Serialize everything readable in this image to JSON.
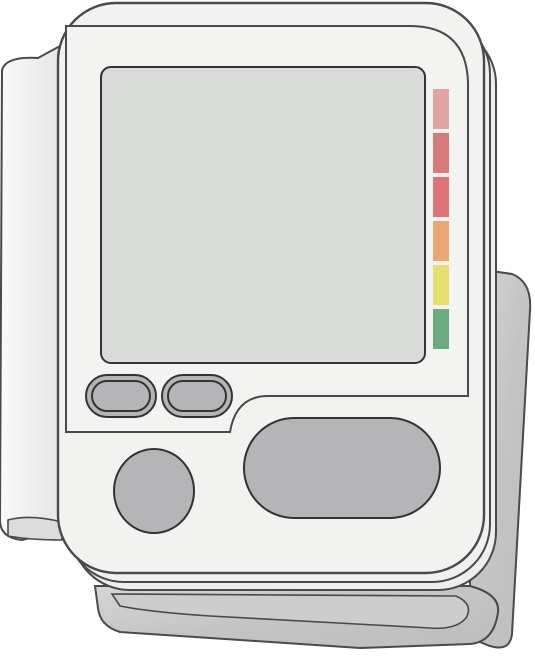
{
  "device": {
    "type": "wrist blood pressure monitor",
    "colors": {
      "body": "#f2f2f0",
      "outline": "#4a4a4a",
      "screen": "#d9dbd9",
      "buttons": "#b5b5b7",
      "cuff": "#c8c8c8",
      "strap": "#eeeeee"
    },
    "indicator_levels": [
      {
        "level": "level-1",
        "color": "#e2a3a3"
      },
      {
        "level": "level-2",
        "color": "#d97a7a"
      },
      {
        "level": "level-3",
        "color": "#de7478"
      },
      {
        "level": "level-4",
        "color": "#eba676"
      },
      {
        "level": "level-5",
        "color": "#e5df6f"
      },
      {
        "level": "level-6",
        "color": "#6aab80"
      }
    ],
    "buttons": [
      {
        "id": "small-left",
        "icon": "pill-button"
      },
      {
        "id": "small-right",
        "icon": "pill-button"
      },
      {
        "id": "round",
        "icon": "round-button"
      },
      {
        "id": "start",
        "icon": "oval-button"
      }
    ]
  }
}
